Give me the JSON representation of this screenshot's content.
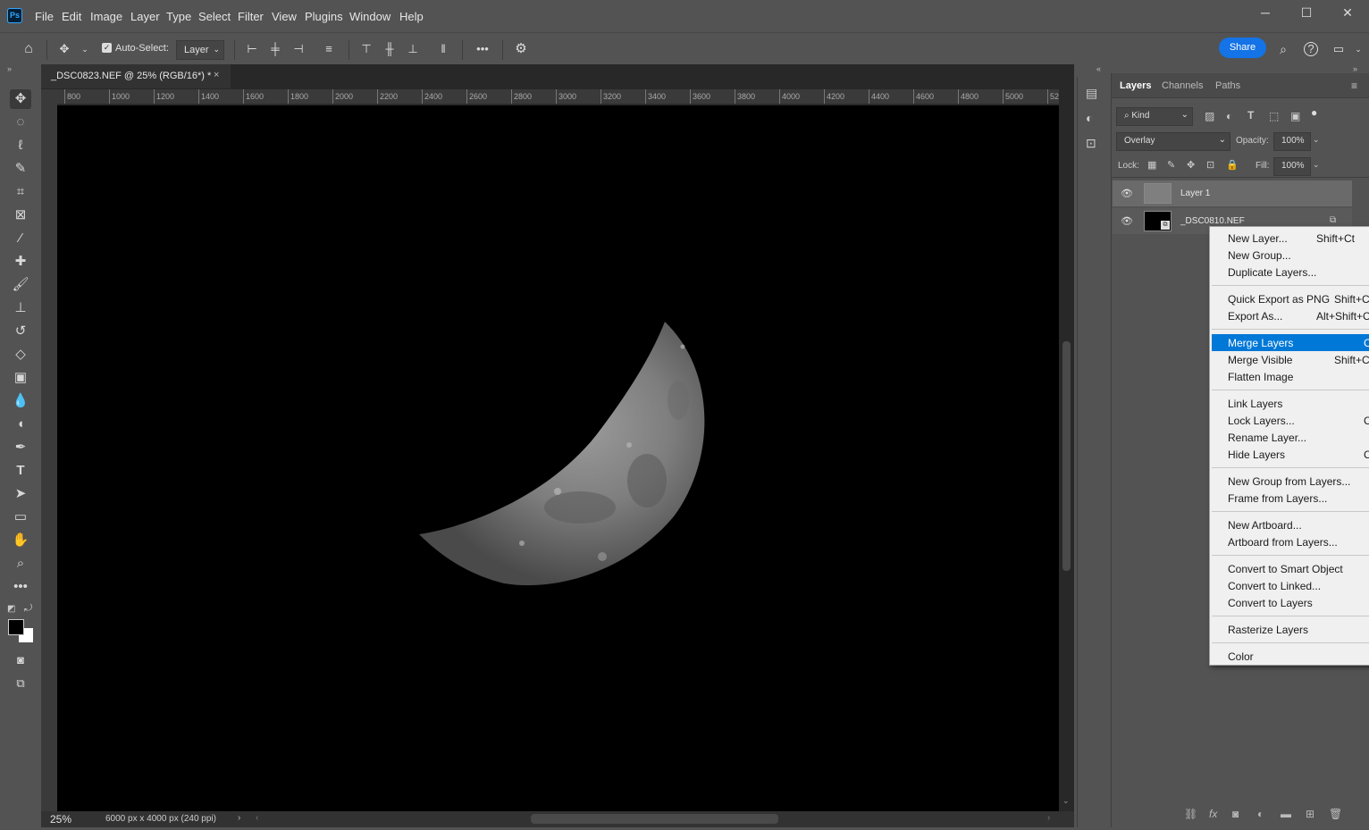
{
  "menu": [
    "File",
    "Edit",
    "Image",
    "Layer",
    "Type",
    "Select",
    "Filter",
    "View",
    "Plugins",
    "Window",
    "Help"
  ],
  "app_logo": "Ps",
  "options": {
    "auto_select_label": "Auto-Select:",
    "auto_select_target": "Layer",
    "share_label": "Share"
  },
  "document": {
    "tab_title": "_DSC0823.NEF @ 25% (RGB/16*) *",
    "close": "×",
    "zoom": "25%",
    "info": "6000 px x 4000 px (240 ppi)"
  },
  "ruler_h": [
    "800",
    "1000",
    "1200",
    "1400",
    "1600",
    "1800",
    "2000",
    "2200",
    "2400",
    "2600",
    "2800",
    "3000",
    "3200",
    "3400",
    "3600",
    "3800",
    "4000",
    "4200",
    "4400",
    "4600",
    "4800",
    "5000",
    "52"
  ],
  "layers_panel": {
    "tabs": [
      "Layers",
      "Channels",
      "Paths"
    ],
    "filter_kind": "Kind",
    "blend_mode": "Overlay",
    "opacity_label": "Opacity:",
    "opacity": "100%",
    "lock_label": "Lock:",
    "fill_label": "Fill:",
    "fill": "100%",
    "layers": [
      {
        "name": "Layer 1",
        "selected": true
      },
      {
        "name": "_DSC0810.NEF",
        "selected": false
      }
    ]
  },
  "context_menu": {
    "groups": [
      [
        {
          "label": "New Layer...",
          "shortcut": "Shift+Ct"
        },
        {
          "label": "New Group...",
          "shortcut": ""
        },
        {
          "label": "Duplicate Layers...",
          "shortcut": ""
        }
      ],
      [
        {
          "label": "Quick Export as PNG",
          "shortcut": "Shift+C"
        },
        {
          "label": "Export As...",
          "shortcut": "Alt+Shift+C"
        }
      ],
      [
        {
          "label": "Merge Layers",
          "shortcut": "C",
          "highlighted": true
        },
        {
          "label": "Merge Visible",
          "shortcut": "Shift+C"
        },
        {
          "label": "Flatten Image",
          "shortcut": ""
        }
      ],
      [
        {
          "label": "Link Layers",
          "shortcut": ""
        },
        {
          "label": "Lock Layers...",
          "shortcut": "C"
        },
        {
          "label": "Rename Layer...",
          "shortcut": ""
        },
        {
          "label": "Hide Layers",
          "shortcut": "C"
        }
      ],
      [
        {
          "label": "New Group from Layers...",
          "shortcut": ""
        },
        {
          "label": "Frame from Layers...",
          "shortcut": ""
        }
      ],
      [
        {
          "label": "New Artboard...",
          "shortcut": ""
        },
        {
          "label": "Artboard from Layers...",
          "shortcut": ""
        }
      ],
      [
        {
          "label": "Convert to Smart Object",
          "shortcut": ""
        },
        {
          "label": "Convert to Linked...",
          "shortcut": ""
        },
        {
          "label": "Convert to Layers",
          "shortcut": ""
        }
      ],
      [
        {
          "label": "Rasterize Layers",
          "shortcut": ""
        }
      ],
      [
        {
          "label": "Color",
          "shortcut": ""
        }
      ]
    ]
  },
  "colors": {
    "accent": "#1473e6",
    "highlight": "#0078d7",
    "ui_bg": "#535353",
    "canvas_bg": "#000000"
  }
}
